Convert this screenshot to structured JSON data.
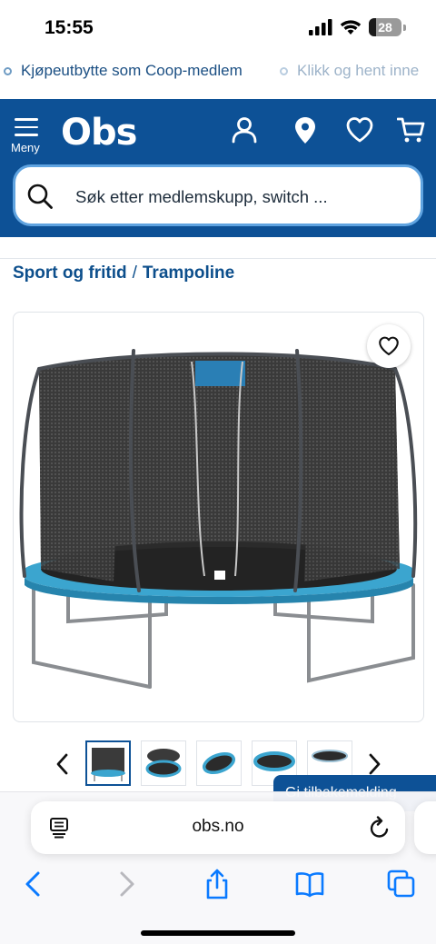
{
  "status_bar": {
    "time": "15:55",
    "battery_level": "28"
  },
  "ticker": {
    "items": [
      "Kjøpeutbytte som Coop-medlem",
      "Klikk og hent inne"
    ]
  },
  "header": {
    "menu_label": "Meny",
    "logo_text": "Obs",
    "icons": [
      "user-icon",
      "location-pin-icon",
      "heart-icon",
      "cart-icon"
    ],
    "search_placeholder": "Søk etter medlemskupp, switch ..."
  },
  "breadcrumb": {
    "items": [
      "Sport og fritid",
      "Trampoline"
    ],
    "separator": "/"
  },
  "product": {
    "favorite_icon": "heart-outline-icon",
    "thumbnail_count": 5,
    "active_thumbnail": 1
  },
  "notice_button": {
    "label": "Gi tilbakemelding"
  },
  "browser": {
    "url": "obs.no",
    "toolbar_icons": [
      "back-icon",
      "forward-icon",
      "share-icon",
      "bookmarks-icon",
      "tabs-icon"
    ]
  },
  "colors": {
    "brand_blue": "#0d5196",
    "link_blue": "#0d4f8c",
    "search_border": "#5fa3e0",
    "ios_blue": "#0a7aff"
  }
}
